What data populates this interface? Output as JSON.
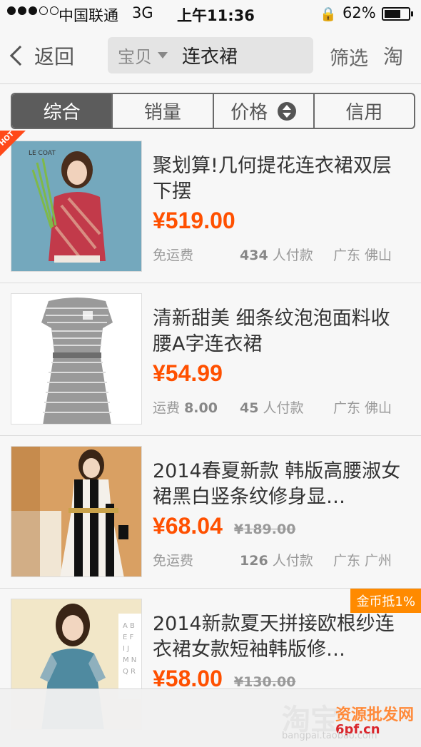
{
  "status_bar": {
    "carrier": "中国联通",
    "network": "3G",
    "time": "上午11:36",
    "battery": "62%",
    "battery_level": 0.62,
    "signal_bars_filled": 3,
    "signal_bars_total": 5
  },
  "nav": {
    "back_label": "返回",
    "search_scope": "宝贝",
    "search_query": "连衣裙",
    "filter_label": "筛选",
    "logo_glyph": "淘"
  },
  "tabs": [
    {
      "label": "综合",
      "active": true
    },
    {
      "label": "销量",
      "active": false
    },
    {
      "label": "价格",
      "active": false
    },
    {
      "label": "信用",
      "active": false
    }
  ],
  "products": [
    {
      "title": "聚划算!几何提花连衣裙双层下摆",
      "price": "¥519.00",
      "old_price": "",
      "shipping": "免运费",
      "buyers_count": "434",
      "buyers_suffix": "人付款",
      "location": "广东 佛山",
      "badge": "HOT",
      "thumb_brand": "LE COAT",
      "thumb_colors": [
        "#6fa3b8",
        "#c23a4a",
        "#e7c7a8"
      ]
    },
    {
      "title": "清新甜美 细条纹泡泡面料收腰A字连衣裙",
      "price": "¥54.99",
      "old_price": "",
      "shipping_prefix": "运费",
      "shipping_value": "8.00",
      "buyers_count": "45",
      "buyers_suffix": "人付款",
      "location": "广东 佛山",
      "thumb_colors": [
        "#ffffff",
        "#8c8c8c",
        "#dcdcdc"
      ]
    },
    {
      "title": "2014春夏新款 韩版高腰淑女裙黑白竖条纹修身显…",
      "price": "¥68.04",
      "old_price": "¥189.00",
      "shipping": "免运费",
      "buyers_count": "126",
      "buyers_suffix": "人付款",
      "location": "广东 广州",
      "thumb_colors": [
        "#c98a4a",
        "#1a1a1a",
        "#f4f0ea"
      ]
    },
    {
      "title": "2014新款夏天拼接欧根纱连衣裙女款短袖韩版修…",
      "price": "¥58.00",
      "old_price": "¥130.00",
      "coin_badge": "金币抵1%",
      "thumb_colors": [
        "#f2e7c8",
        "#4f8aa0",
        "#8fb0bd"
      ]
    }
  ],
  "watermark": {
    "big": "淘宝",
    "cn": "资源批发网",
    "domain": "6pf.cn",
    "url": "bangpai.taobao.com"
  },
  "colors": {
    "price": "#ff5000",
    "active_tab": "#5c5c5c",
    "hot_badge": "#ff4a1a",
    "coin_badge": "#ff8a00"
  }
}
